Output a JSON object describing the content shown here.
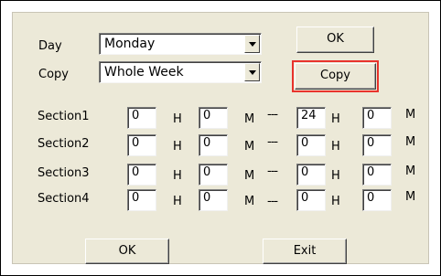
{
  "day_label": "Day",
  "copy_label": "Copy",
  "day_value": "Monday",
  "copy_value": "Whole Week",
  "top_ok_label": "OK",
  "copy_button_label": "Copy",
  "hour_unit": "H",
  "minute_unit": "M",
  "separator": "---",
  "sections": [
    {
      "label": "Section1",
      "start_h": "0",
      "start_m": "0",
      "end_h": "24",
      "end_m": "0"
    },
    {
      "label": "Section2",
      "start_h": "0",
      "start_m": "0",
      "end_h": "0",
      "end_m": "0"
    },
    {
      "label": "Section3",
      "start_h": "0",
      "start_m": "0",
      "end_h": "0",
      "end_m": "0"
    },
    {
      "label": "Section4",
      "start_h": "0",
      "start_m": "0",
      "end_h": "0",
      "end_m": "0"
    }
  ],
  "bottom_ok_label": "OK",
  "exit_label": "Exit",
  "highlight_color": "#e8332c"
}
